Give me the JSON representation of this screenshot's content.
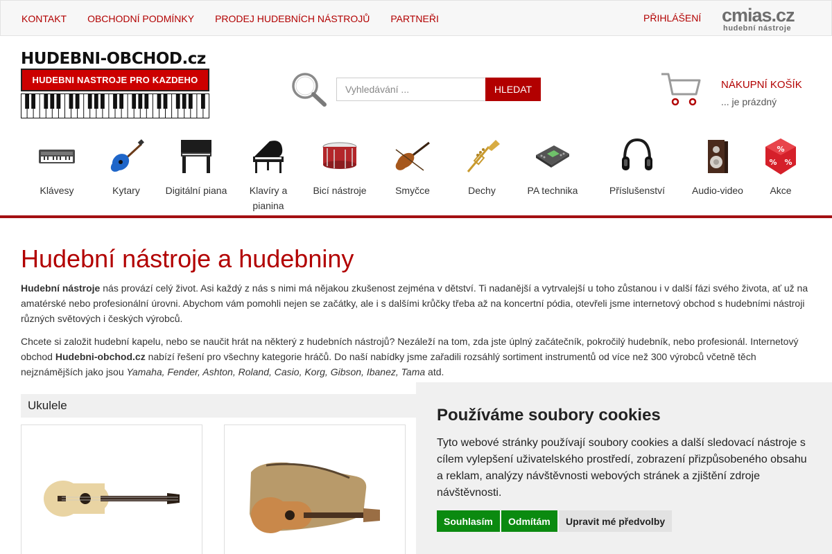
{
  "topnav": {
    "items": [
      "KONTAKT",
      "OBCHODNÍ PODMÍNKY",
      "PRODEJ HUDEBNÍCH NÁSTROJŮ",
      "PARTNEŘI"
    ],
    "login": "PŘIHLÁŠENÍ"
  },
  "partner_logo": {
    "name": "cmias.cz",
    "tagline": "hudební nástroje"
  },
  "logo": {
    "title": "HUDEBNI-OBCHOD.cz",
    "tagline": "HUDEBNI NASTROJE PRO KAZDEHO"
  },
  "search": {
    "placeholder": "Vyhledávání ...",
    "button": "HLEDAT"
  },
  "cart": {
    "title": "NÁKUPNÍ KOŠÍK",
    "status": "... je prázdný"
  },
  "categories": [
    {
      "label": "Klávesy",
      "icon": "keyboard-icon"
    },
    {
      "label": "Kytary",
      "icon": "guitar-icon"
    },
    {
      "label": "Digitální piana",
      "icon": "digital-piano-icon"
    },
    {
      "label": "Klavíry a pianina",
      "icon": "grand-piano-icon"
    },
    {
      "label": "Bicí nástroje",
      "icon": "drum-icon"
    },
    {
      "label": "Smyčce",
      "icon": "violin-icon"
    },
    {
      "label": "Dechy",
      "icon": "trumpet-icon"
    },
    {
      "label": "PA technika",
      "icon": "mixer-icon"
    },
    {
      "label": "Příslušenství",
      "icon": "headphones-icon"
    },
    {
      "label": "Audio-video",
      "icon": "speaker-icon"
    },
    {
      "label": "Akce",
      "icon": "discount-icon"
    }
  ],
  "main": {
    "heading": "Hudební nástroje a hudebniny",
    "p1": {
      "bold": "Hudební nástroje",
      "text": " nás provází celý život. Asi každý z nás s nimi má nějakou zkušenost zejména v dětství. Ti nadanější a vytrvalejší u toho zůstanou i v další fázi svého života, ať už na amatérské nebo profesionální úrovni. Abychom vám pomohli nejen se začátky, ale i s dalšími krůčky třeba až na koncertní pódia, otevřeli jsme internetový obchod s hudebními nástroji různých světových i českých výrobců."
    },
    "p2": {
      "text1": "Chcete si založit hudební kapelu, nebo se naučit hrát na některý z hudebních nástrojů? Nezáleží na tom, zda jste úplný začátečník, pokročilý hudebník, nebo profesionál. Internetový obchod ",
      "bold": "Hudebni-obchod.cz",
      "text2": " nabízí řešení pro všechny kategorie hráčů. Do naší nabídky jsme zařadili rozsáhlý sortiment instrumentů od více než 300 výrobců včetně těch nejznámějších jako jsou ",
      "brands": "Yamaha, Fender, Ashton, Roland, Casio, Korg, Gibson, Ibanez, Tama",
      "text3": " atd."
    },
    "section_title": "Ukulele"
  },
  "cookie": {
    "title": "Používáme soubory cookies",
    "text": "Tyto webové stránky používají soubory cookies a další sledovací nástroje s cílem vylepšení uživatelského prostředí, zobrazení přizpůsobeného obsahu a reklam, analýzy návštěvnosti webových stránek a zjištění zdroje návštěvnosti.",
    "accept": "Souhlasím",
    "reject": "Odmítám",
    "prefs": "Upravit mé předvolby"
  },
  "colors": {
    "brand_red": "#b20000",
    "accent_green": "#0b8a10",
    "divider": "#a30f12"
  }
}
